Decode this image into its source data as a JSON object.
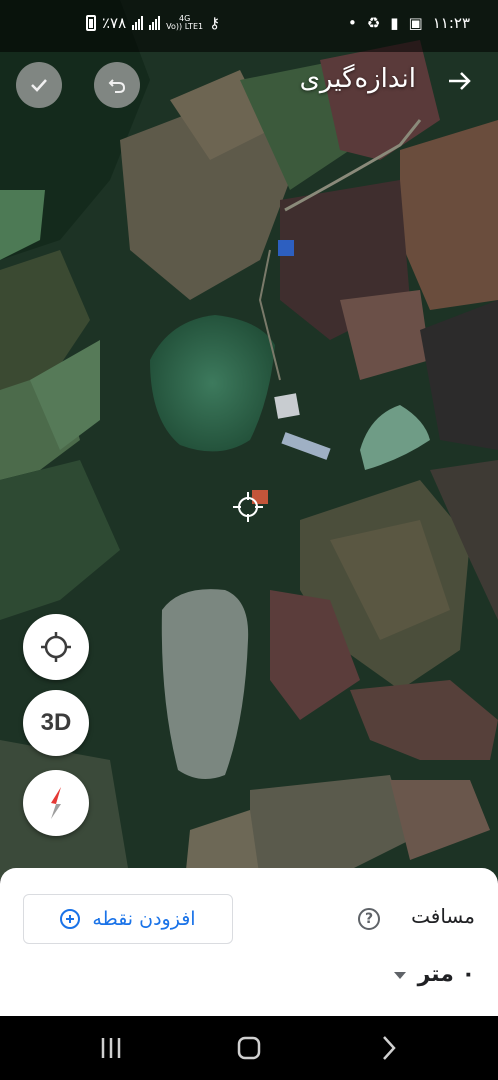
{
  "status": {
    "battery": "٪۷۸",
    "network_top": "4G",
    "network_bottom": "Vo)) LTE1",
    "time": "۱۱:۲۳"
  },
  "toolbar": {
    "title": "اندازه‌گیری",
    "confirm_icon": "check-icon",
    "undo_icon": "undo-icon",
    "back_icon": "arrow-right-icon"
  },
  "controls": {
    "location_icon": "my-location-icon",
    "three_d_label": "3D",
    "compass_icon": "compass-icon"
  },
  "sheet": {
    "add_point_label": "افزودن نقطه",
    "distance_label": "مسافت",
    "distance_value": "۰ متر"
  },
  "navbar": {
    "recent_icon": "recent-apps-icon",
    "home_icon": "home-icon",
    "back_icon": "back-icon"
  }
}
